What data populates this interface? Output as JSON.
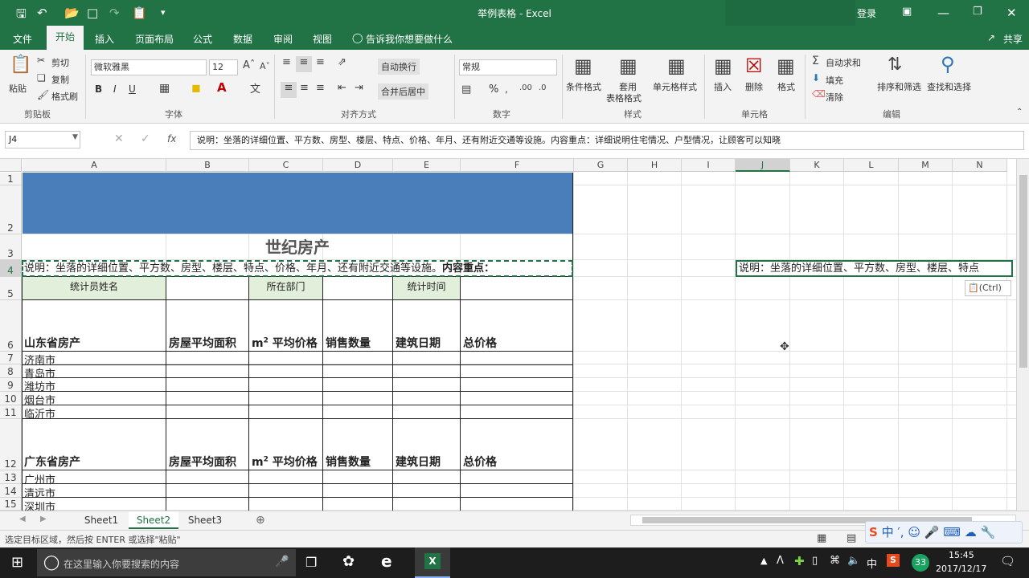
{
  "window": {
    "title": "举例表格 - Excel",
    "login": "登录",
    "share": "共享"
  },
  "tabs": [
    "文件",
    "开始",
    "插入",
    "页面布局",
    "公式",
    "数据",
    "审阅",
    "视图"
  ],
  "tell_me": "告诉我你想要做什么",
  "ribbon": {
    "clipboard": {
      "paste": "粘贴",
      "cut": "剪切",
      "copy": "复制",
      "format_painter": "格式刷",
      "label": "剪贴板"
    },
    "font": {
      "name": "微软雅黑",
      "size": "12",
      "bold": "B",
      "italic": "I",
      "underline": "U",
      "label": "字体"
    },
    "alignment": {
      "wrap": "自动换行",
      "merge": "合并后居中",
      "label": "对齐方式"
    },
    "number": {
      "format": "常规",
      "percent": "%",
      "label": "数字"
    },
    "styles": {
      "conditional": "条件格式",
      "table_line1": "套用",
      "table_line2": "表格格式",
      "cell_styles": "单元格样式",
      "label": "样式"
    },
    "cells": {
      "insert": "插入",
      "delete": "删除",
      "format": "格式",
      "label": "单元格"
    },
    "editing": {
      "autosum": "自动求和",
      "fill": "填充",
      "clear": "清除",
      "sort": "排序和筛选",
      "find": "查找和选择",
      "label": "编辑"
    }
  },
  "formula": {
    "name_box": "J4",
    "fx": "fx",
    "content": "说明：坐落的详细位置、平方数、房型、楼层、特点、价格、年月、还有附近交通等设施。内容重点：详细说明住宅情况、户型情况，让顾客可以知晓"
  },
  "columns": [
    "A",
    "B",
    "C",
    "D",
    "E",
    "F",
    "G",
    "H",
    "I",
    "J",
    "K",
    "L",
    "M",
    "N"
  ],
  "rows": [
    "1",
    "2",
    "3",
    "4",
    "5",
    "6",
    "7",
    "8",
    "9",
    "10",
    "11",
    "12",
    "13",
    "14",
    "15"
  ],
  "sheet": {
    "title": "世纪房产",
    "note": "说明：坐落的详细位置、平方数、房型、楼层、特点、价格、年月、还有附近交通等设施。",
    "note_bold": "内容重点：",
    "paste_preview": "说明：坐落的详细位置、平方数、房型、楼层、特点",
    "paste_ctrl": "(Ctrl)",
    "row5": {
      "a": "统计员姓名",
      "c": "所在部门",
      "e": "统计时间"
    },
    "sd": {
      "title": "山东省房产",
      "h_area": "房屋平均面积",
      "h_price_unit": "m",
      "h_price_sup": "2",
      "h_price": " 平均价格",
      "h_qty": "销售数量",
      "h_date": "建筑日期",
      "h_total": "总价格",
      "cities": [
        "济南市",
        "青岛市",
        "潍坊市",
        "烟台市",
        "临沂市"
      ]
    },
    "gd": {
      "title": "广东省房产",
      "h_area": "房屋平均面积",
      "h_price_unit": "m",
      "h_price_sup": "2",
      "h_price": " 平均价格",
      "h_qty": "销售数量",
      "h_date": "建筑日期",
      "h_total": "总价格",
      "cities": [
        "广州市",
        "清远市",
        "深圳市"
      ]
    }
  },
  "sheet_tabs": [
    "Sheet1",
    "Sheet2",
    "Sheet3"
  ],
  "status_text": "选定目标区域，然后按 ENTER 或选择\"粘贴\"",
  "taskbar": {
    "search": "在这里输入你要搜索的内容",
    "time": "15:45",
    "date": "2017/12/17",
    "ime": "中",
    "badge": "33"
  },
  "colors": {
    "accent": "#217346",
    "header_fill": "#4a7eba",
    "label_fill": "#e2efda"
  }
}
